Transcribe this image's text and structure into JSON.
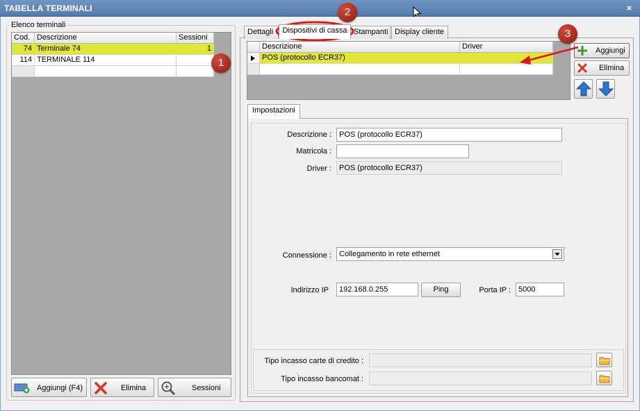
{
  "window": {
    "title": "TABELLA TERMINALI",
    "close_glyph": "×"
  },
  "left_panel": {
    "legend": "Elenco terminali",
    "columns": [
      "Cod.",
      "Descrizione",
      "Sessioni"
    ],
    "rows": [
      {
        "cod": "74",
        "descrizione": "Terminale 74",
        "sessioni": "1",
        "selected": true
      },
      {
        "cod": "114",
        "descrizione": "TERMINALE 114",
        "sessioni": "",
        "selected": false
      }
    ],
    "buttons": {
      "add": "Aggiungi (F4)",
      "delete": "Elimina",
      "sessions": "Sessioni"
    }
  },
  "tabs": [
    "Dettagli",
    "Dispositivi di cassa",
    "Stampanti",
    "Display cliente"
  ],
  "active_tab": 1,
  "devices_grid": {
    "columns": [
      "Descrizione",
      "Driver"
    ],
    "rows": [
      {
        "descrizione": "POS (protocollo ECR37)",
        "driver": "",
        "selected": true
      }
    ]
  },
  "device_buttons": {
    "add": "Aggiungi",
    "delete": "Elimina"
  },
  "settings": {
    "tab": "Impostazioni",
    "descrizione_label": "Descrizione :",
    "descrizione_value": "POS (protocollo ECR37)",
    "matricola_label": "Matricola :",
    "matricola_value": "",
    "driver_label": "Driver :",
    "driver_value": "POS (protocollo ECR37)",
    "connessione_label": "Connessione :",
    "connessione_value": "Collegamento in rete ethernet",
    "ip_label": "Indirizzo IP",
    "ip_value": "192.168.0.255",
    "ping_label": "Ping",
    "porta_label": "Porta IP :",
    "porta_value": "5000",
    "carte_label": "Tipo incasso carte di credito :",
    "carte_value": "",
    "bancomat_label": "Tipo incasso bancomat :",
    "bancomat_value": ""
  },
  "badges": [
    "1",
    "2",
    "3"
  ],
  "colors": {
    "selection": "#e1e636",
    "title_bar": "#5f86b8",
    "badge": "#b52c22",
    "annotation": "#e01515"
  },
  "icons": [
    "add-terminal-icon",
    "delete-x-icon",
    "magnifier-icon",
    "plus-icon",
    "move-up-icon",
    "move-down-icon",
    "folder-icon",
    "row-pointer-icon",
    "dropdown-arrow-icon",
    "mouse-cursor-icon"
  ]
}
